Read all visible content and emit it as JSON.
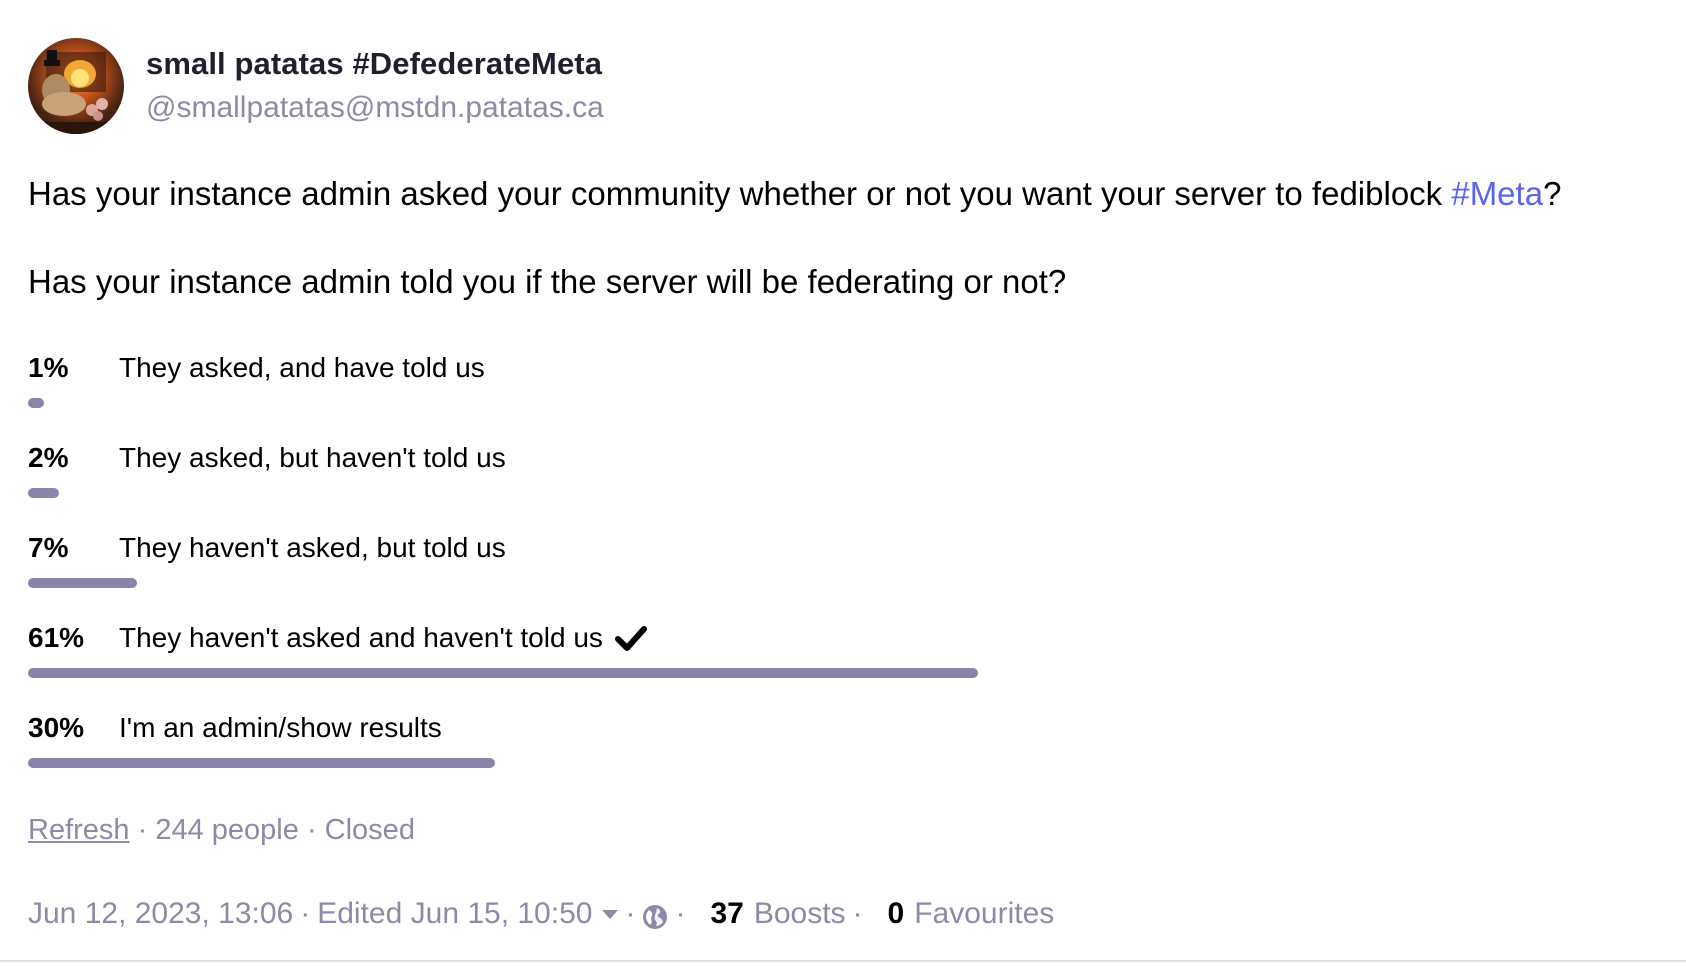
{
  "author": {
    "display_name": "small patatas #DefederateMeta",
    "account": "@smallpatatas@mstdn.patatas.ca",
    "avatar_icon": "avatar-fireplace-figure"
  },
  "content": {
    "line1_text": "Has your instance admin asked your community whether or not you want your server to fediblock ",
    "line1_hashtag": "#Meta",
    "line1_end": "?",
    "line2_text": "Has your instance admin told you if the server will be federating or not?"
  },
  "poll": {
    "options": [
      {
        "percent_label": "1%",
        "label": "They asked, and have told us",
        "fraction": 0.01,
        "voted": false
      },
      {
        "percent_label": "2%",
        "label": "They asked, but haven't told us",
        "fraction": 0.02,
        "voted": false
      },
      {
        "percent_label": "7%",
        "label": "They haven't asked, but told us",
        "fraction": 0.07,
        "voted": false
      },
      {
        "percent_label": "61%",
        "label": "They haven't asked and haven't told us",
        "fraction": 0.61,
        "voted": true
      },
      {
        "percent_label": "30%",
        "label": "I'm an admin/show results",
        "fraction": 0.3,
        "voted": false
      }
    ],
    "refresh_label": "Refresh",
    "separator": "·",
    "voters": "244 people",
    "state": "Closed",
    "bar_color": "#8c83ab"
  },
  "meta": {
    "date": "Jun 12, 2023, 13:06",
    "edited": "Edited Jun 15, 10:50",
    "visibility_icon": "globe-icon",
    "boosts_count": "37",
    "boosts_label": "Boosts",
    "favourites_count": "0",
    "favourites_label": "Favourites",
    "separator": "·"
  },
  "colors": {
    "muted": "#8f89a8",
    "hashtag": "#5964f0",
    "text": "#000000"
  }
}
